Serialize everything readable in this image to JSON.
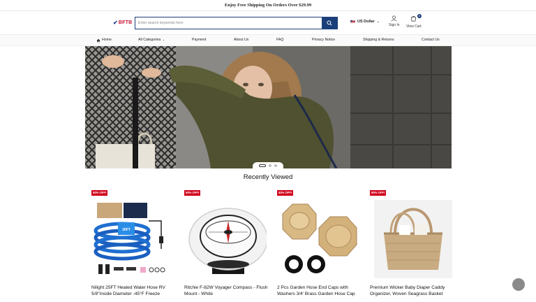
{
  "announcement": "Enjoy Free Shipping On Orders Over $29.99",
  "header": {
    "logo_text": "BFTB",
    "search_placeholder": "Enter search keywords here",
    "currency": "US Dollar",
    "sign_in": "Sign In",
    "view_cart": "View Cart",
    "cart_count": "0"
  },
  "nav": [
    {
      "label": "Home",
      "icon": "home-icon"
    },
    {
      "label": "All Categories",
      "icon": "chevron-down-icon"
    },
    {
      "label": "Payment"
    },
    {
      "label": "About Us"
    },
    {
      "label": "FAQ"
    },
    {
      "label": "Privacy Notice"
    },
    {
      "label": "Shipping & Returns"
    },
    {
      "label": "Contact Us"
    }
  ],
  "carousel": {
    "slides": 3,
    "active": 1
  },
  "recently_viewed": {
    "title": "Recently Viewed",
    "products": [
      {
        "badge": "50% OFF!",
        "title": "Nilight 25FT Heated Water Hose RV 5/8\"Inside Diameter -45°F Freeze",
        "image": "blue-heated-hose",
        "label_text": "30FT"
      },
      {
        "badge": "50% OFF!",
        "title": "Ritchie F-82W Voyager Compass - Flush Mount - White",
        "image": "marine-compass"
      },
      {
        "badge": "40% OFF!",
        "title": "2 Pcs Garden Hose End Caps with Washers 3/4' Brass Garden Hose Cap",
        "image": "brass-hose-caps"
      },
      {
        "badge": "50% OFF!",
        "title": "Premium Wicker Baby Diaper Caddy Organizer, Woven Seagrass Basket",
        "image": "wicker-basket"
      }
    ]
  },
  "colors": {
    "brand_navy": "#1b3f7a",
    "sale_red": "#d0021b",
    "logo_red": "#c8102e"
  }
}
